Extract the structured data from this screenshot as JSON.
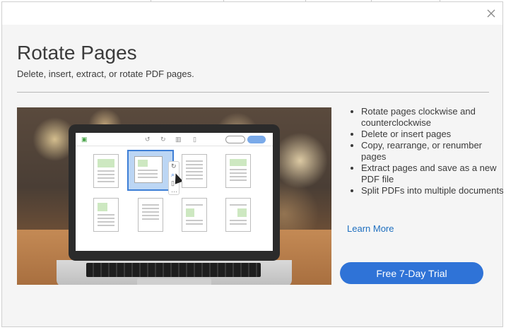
{
  "dialog": {
    "title": "Rotate Pages",
    "subtitle": "Delete, insert, extract, or rotate PDF pages.",
    "close_icon": "close-icon",
    "features": [
      "Rotate pages clockwise and counterclockwise",
      "Delete or insert pages",
      "Copy, rearrange, or renumber pages",
      "Extract pages and save as a new PDF file",
      "Split PDFs into multiple documents"
    ],
    "learn_more_label": "Learn More",
    "trial_button_label": "Free 7-Day Trial"
  },
  "colors": {
    "accent": "#2f73d7",
    "link": "#1f6fbf",
    "title_text": "#3b3b3b",
    "dialog_background": "#f5f5f5"
  },
  "hero_image": {
    "toolbar_icons": [
      "organize-pages-icon",
      "rotate-counterclockwise-icon",
      "rotate-clockwise-icon",
      "delete-icon",
      "insert-page-icon"
    ],
    "palette_icons": [
      "rotate-icon",
      "zoom-icon",
      "insert-icon",
      "more-icon"
    ]
  }
}
